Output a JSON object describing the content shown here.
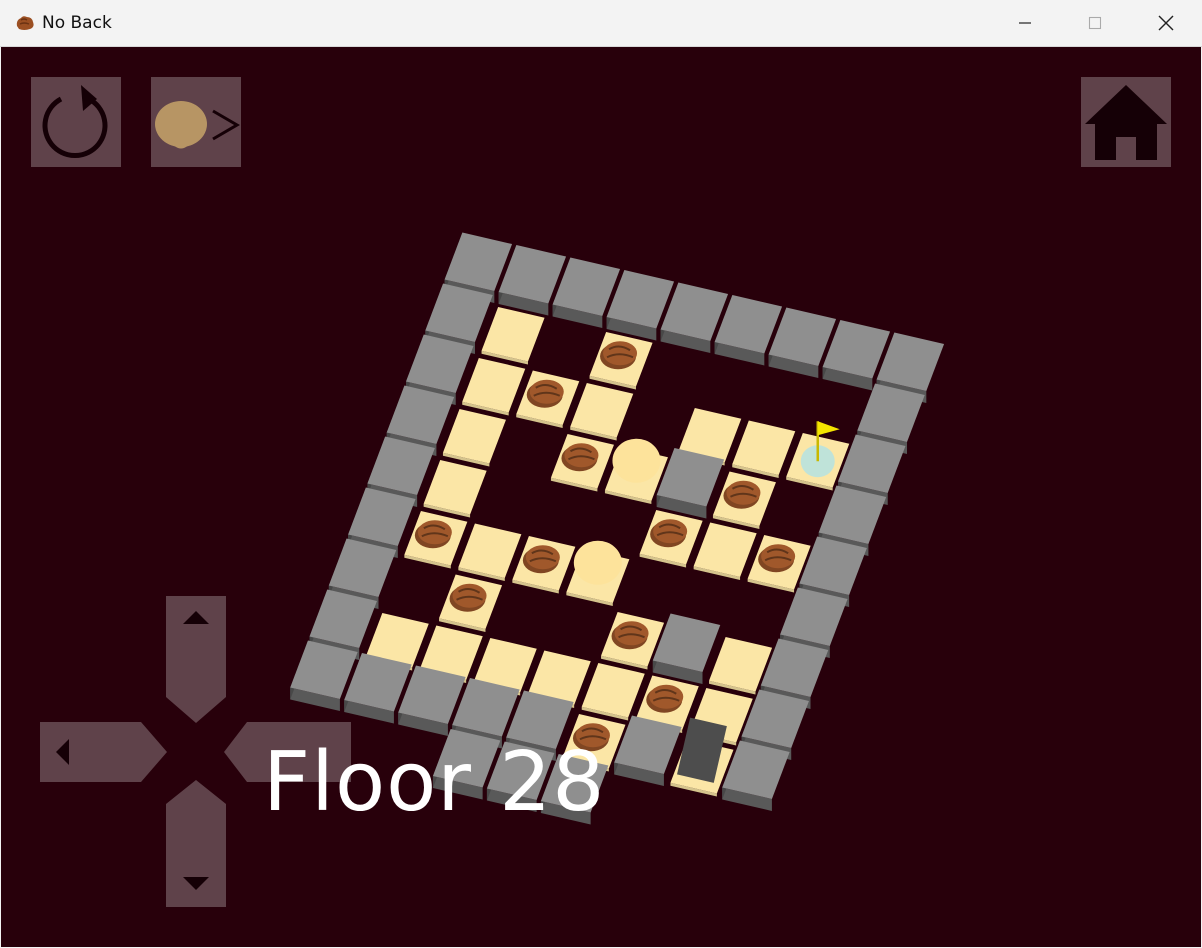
{
  "window": {
    "title": "No Back",
    "icon": "brown-rock-icon",
    "controls": [
      "minimize-icon",
      "maximize-icon",
      "close-icon"
    ]
  },
  "toolbar": {
    "restart_icon": "restart-icon",
    "skip_icon": "skip-ball-icon",
    "skip_symbol": ">",
    "home_icon": "home-icon"
  },
  "dpad": {
    "up_icon": "arrow-up-icon",
    "down_icon": "arrow-down-icon",
    "left_icon": "arrow-left-icon",
    "right_icon": "arrow-right-icon"
  },
  "game": {
    "floor_label": "Floor 28",
    "colors": {
      "background": "#28000b",
      "wall": "#8f8f8f",
      "tile": "#fbe6a6",
      "rock": "#a0582b",
      "ball": "#fde39b",
      "goal_flag": "#f4e400",
      "goal_circle": "#bfe3d9",
      "hole": "#4d4d4d"
    },
    "board": [
      "WWWWWWWWW",
      "WT.R....W",
      "WTRT.TTGW",
      "WT.RPWR.W",
      "WT...RTRW",
      "WRTRP...W",
      "W.R..RWTW",
      "WTTTTTRTW",
      "WWWWWRWHW",
      "...WWW..."
    ]
  }
}
